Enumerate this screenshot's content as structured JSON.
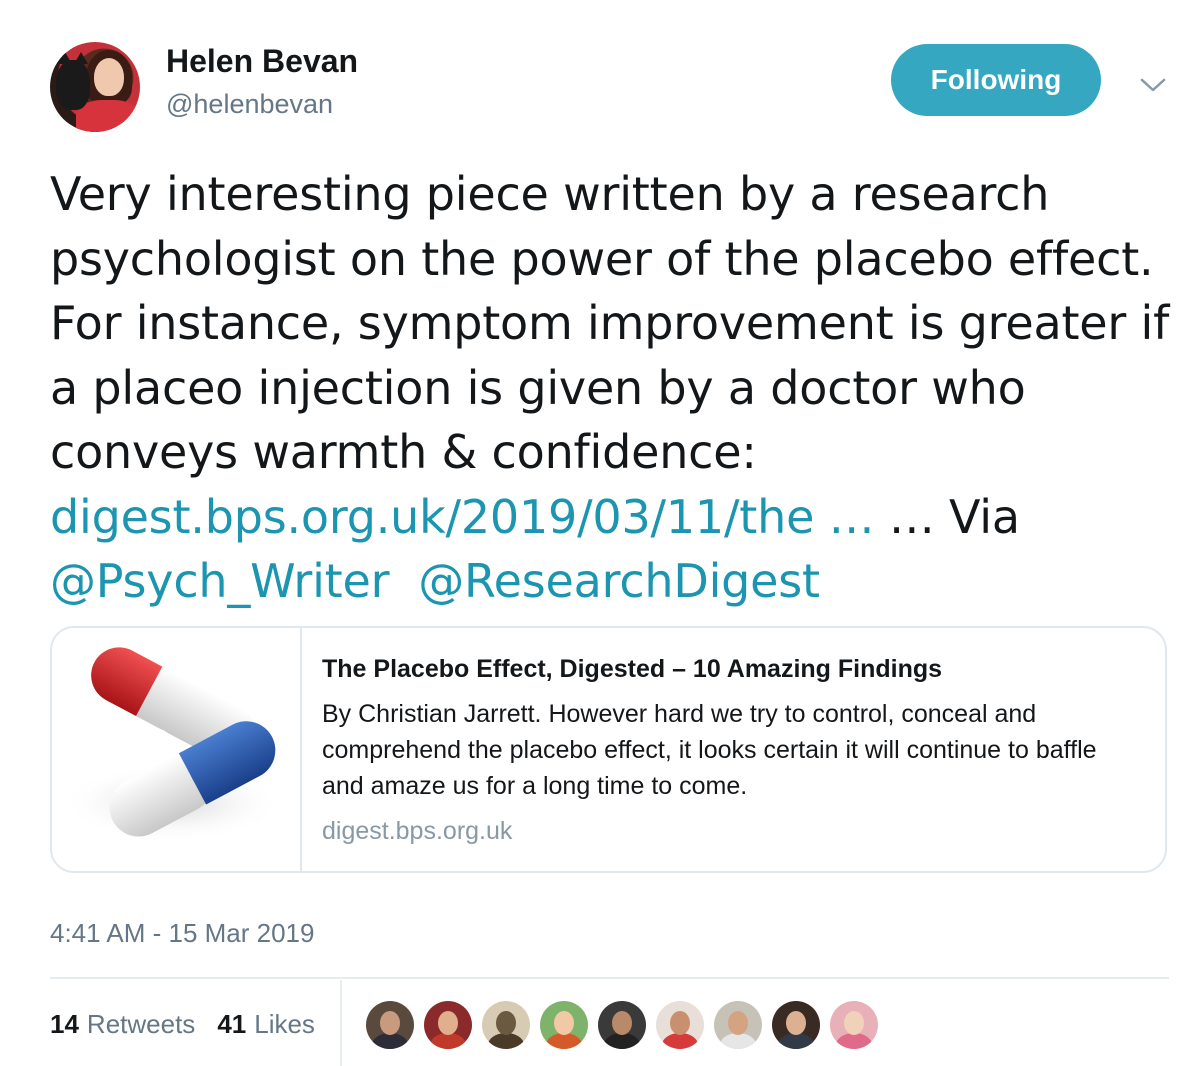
{
  "author": {
    "display_name": "Helen Bevan",
    "handle": "@helenbevan"
  },
  "follow_button": {
    "label": "Following",
    "color": "#35a7c1"
  },
  "tweet": {
    "text_intro": "Very interesting piece written by a research psychologist on the power of the placebo effect. For instance, symptom improvement is greater if a placeo injection is given by a doctor who conveys warmth & confidence: ",
    "link_text": "digest.bps.org.uk/2019/03/11/the …",
    "text_via": " … Via ",
    "mention_1": "@Psych_Writer",
    "mention_2": "@ResearchDigest"
  },
  "card": {
    "image_icon": "pill-capsules-image",
    "title": "The Placebo Effect, Digested – 10 Amazing Findings",
    "description": "By Christian Jarrett. However hard we try to control, conceal and comprehend the placebo effect, it looks certain it will continue to baffle and amaze us for a long time to come.",
    "domain": "digest.bps.org.uk"
  },
  "timestamp": "4:41 AM - 15 Mar 2019",
  "stats": {
    "retweets_count": "14",
    "retweets_label": "Retweets",
    "likes_count": "41",
    "likes_label": "Likes"
  },
  "likers": [
    {
      "face": "#c89a7e",
      "bg": "#5a4a3e",
      "body": "#2d2d3a"
    },
    {
      "face": "#e0b08e",
      "bg": "#8a2a2a",
      "body": "#c0392b"
    },
    {
      "face": "#6b5a40",
      "bg": "#d8cbb4",
      "body": "#4a3a28"
    },
    {
      "face": "#f2c9a6",
      "bg": "#7fb26a",
      "body": "#d45a2a"
    },
    {
      "face": "#b98a6a",
      "bg": "#3a3a3a",
      "body": "#222222"
    },
    {
      "face": "#c8906e",
      "bg": "#e8e0d8",
      "body": "#d63a3a"
    },
    {
      "face": "#d4a382",
      "bg": "#c7c2b8",
      "body": "#e6e6e6"
    },
    {
      "face": "#deb093",
      "bg": "#3a2a24",
      "body": "#303a48"
    },
    {
      "face": "#f0d2b8",
      "bg": "#e8b0b8",
      "body": "#e06a8a"
    }
  ],
  "colors": {
    "link": "#1b95b0",
    "secondary_text": "#657786",
    "border": "#e1e8ed"
  }
}
